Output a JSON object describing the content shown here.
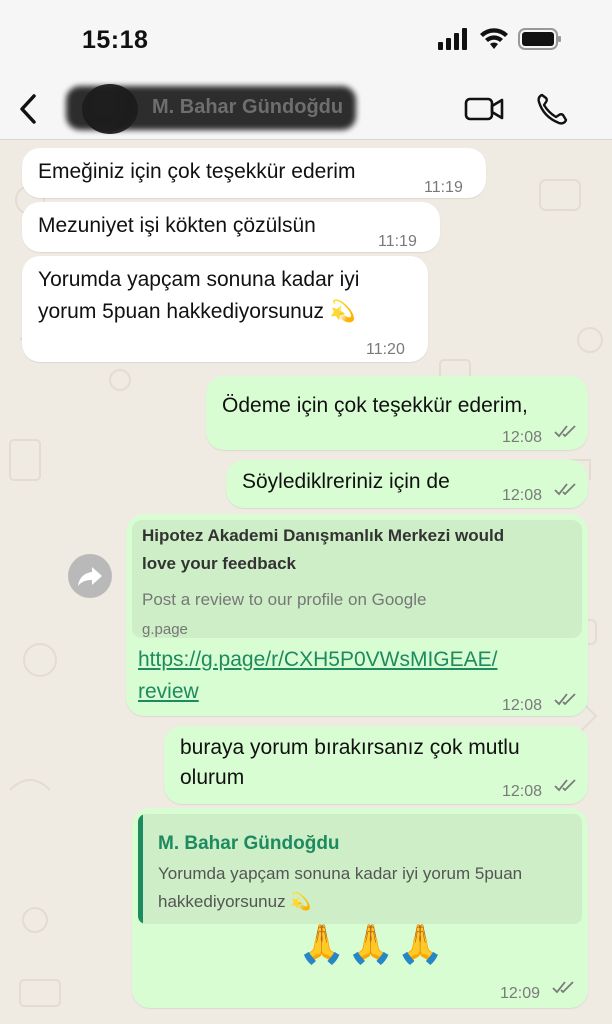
{
  "status": {
    "time": "15:18"
  },
  "header": {
    "contact_name": "M. Bahar Gündoğdu"
  },
  "messages": [
    {
      "text": "Emeğiniz için çok teşekkür ederim",
      "time": "11:19"
    },
    {
      "text": "Mezuniyet işi kökten çözülsün",
      "time": "11:19"
    },
    {
      "line1": "Yorumda yapçam sonuna kadar iyi",
      "line2": "yorum 5puan hakkediyorsunuz 💫",
      "time": "11:20"
    },
    {
      "text": "Ödeme için çok teşekkür ederim,",
      "time": "12:08"
    },
    {
      "text": "Söylediklreriniz için de",
      "time": "12:08"
    },
    {
      "preview_title_1": "Hipotez Akademi Danışmanlık Merkezi would",
      "preview_title_2": "love your feedback",
      "preview_desc": "Post a review to our profile on Google",
      "preview_domain": "g.page",
      "url_1": "https://g.page/r/CXH5P0VWsMIGEAE/",
      "url_2": "review",
      "time": "12:08"
    },
    {
      "line1": "buraya yorum bırakırsanız çok mutlu",
      "line2": "olurum",
      "time": "12:08"
    },
    {
      "quote_name": "M. Bahar Gündoğdu",
      "quote_line1": "Yorumda yapçam sonuna kadar iyi yorum 5puan",
      "quote_line2": "hakkediyorsunuz 💫",
      "text": "🙏🙏🙏",
      "time": "12:09"
    }
  ],
  "icons": [
    "back-icon",
    "video-call-icon",
    "phone-icon",
    "forward-icon",
    "read-ticks-icon",
    "signal-icon",
    "wifi-icon",
    "battery-icon"
  ]
}
